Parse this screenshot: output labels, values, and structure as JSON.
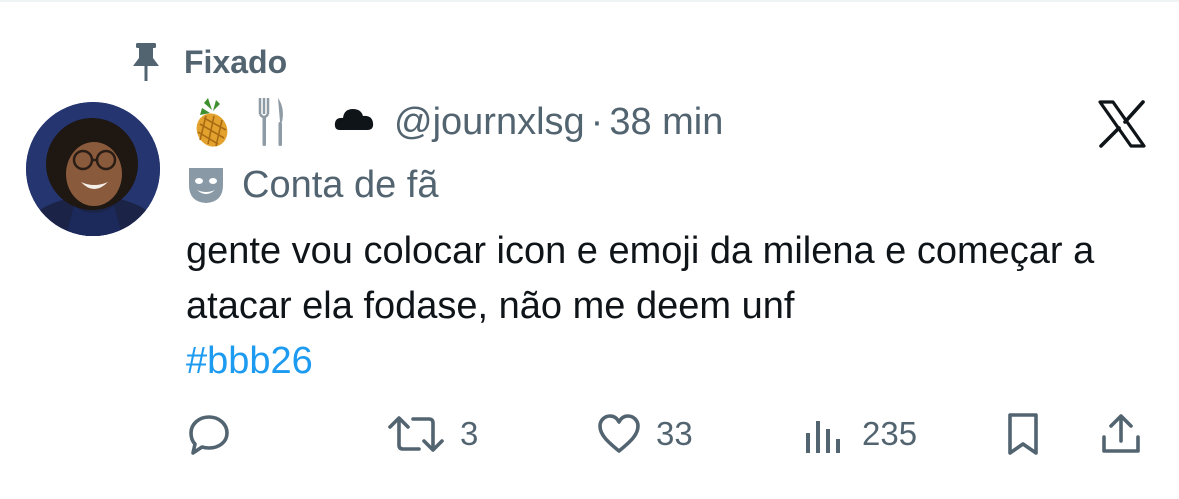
{
  "pinned": {
    "label": "Fixado"
  },
  "author": {
    "display_name_emojis": [
      "🍍",
      "🍴",
      "☁"
    ],
    "handle": "@journxlsg",
    "separator": "·",
    "time": "38 min",
    "badge_label": "Conta de fã"
  },
  "post": {
    "text": "gente vou colocar icon e emoji da milena e começar a atacar ela fodase, não me deem unf",
    "hashtag": "#bbb26"
  },
  "actions": {
    "replies": "",
    "reposts": "3",
    "likes": "33",
    "views": "235"
  },
  "icons": {
    "pin": "pin-icon",
    "brand": "x-logo-icon",
    "badge": "theater-mask-icon",
    "reply": "reply-icon",
    "repost": "repost-icon",
    "like": "heart-icon",
    "views": "views-icon",
    "bookmark": "bookmark-icon",
    "share": "share-icon"
  },
  "colors": {
    "text": "#0f1419",
    "muted": "#536471",
    "link": "#1d9bf0"
  }
}
